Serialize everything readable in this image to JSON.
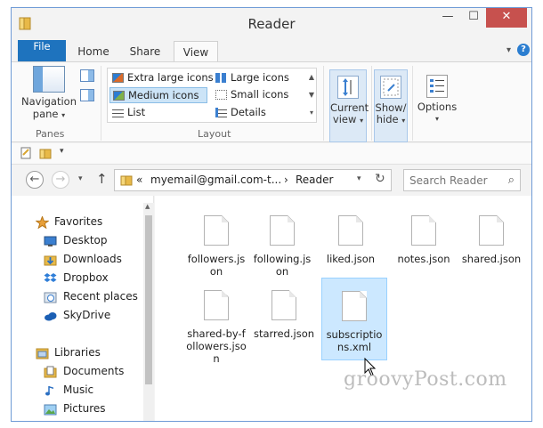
{
  "window": {
    "title": "Reader"
  },
  "tabs": [
    {
      "label": "File"
    },
    {
      "label": "Home"
    },
    {
      "label": "Share"
    },
    {
      "label": "View"
    }
  ],
  "ribbon": {
    "panes": {
      "nav_label_1": "Navigation",
      "nav_label_2": "pane",
      "group_label": "Panes"
    },
    "layout": {
      "group_label": "Layout",
      "options": [
        {
          "label": "Extra large icons",
          "icon": "extra-large-icons-icon"
        },
        {
          "label": "Large icons",
          "icon": "large-icons-icon"
        },
        {
          "label": "Medium icons",
          "icon": "medium-icons-icon",
          "selected": true
        },
        {
          "label": "Small icons",
          "icon": "small-icons-icon"
        },
        {
          "label": "List",
          "icon": "list-icon"
        },
        {
          "label": "Details",
          "icon": "details-icon"
        }
      ]
    },
    "current_view": {
      "line1": "Current",
      "line2": "view"
    },
    "show_hide": {
      "line1": "Show/",
      "line2": "hide"
    },
    "options": {
      "line1": "Options"
    }
  },
  "address": {
    "overflow": "«",
    "crumbs": [
      "myemail@gmail.com-t...",
      "Reader"
    ],
    "separator": "›"
  },
  "search": {
    "placeholder": "Search Reader"
  },
  "sidebar": {
    "items": [
      {
        "label": "Favorites",
        "icon": "star-icon"
      },
      {
        "label": "Desktop",
        "icon": "desktop-icon"
      },
      {
        "label": "Downloads",
        "icon": "downloads-icon"
      },
      {
        "label": "Dropbox",
        "icon": "dropbox-icon"
      },
      {
        "label": "Recent places",
        "icon": "recent-places-icon"
      },
      {
        "label": "SkyDrive",
        "icon": "skydrive-icon"
      },
      {
        "label": "Libraries",
        "icon": "libraries-icon"
      },
      {
        "label": "Documents",
        "icon": "documents-icon"
      },
      {
        "label": "Music",
        "icon": "music-icon"
      },
      {
        "label": "Pictures",
        "icon": "pictures-icon"
      }
    ]
  },
  "files": [
    {
      "name": "followers.json"
    },
    {
      "name": "following.json"
    },
    {
      "name": "liked.json"
    },
    {
      "name": "notes.json"
    },
    {
      "name": "shared.json"
    },
    {
      "name": "shared-by-followers.json"
    },
    {
      "name": "starred.json"
    },
    {
      "name": "subscriptions.xml",
      "selected": true
    }
  ],
  "watermark": "groovyPost.com",
  "colors": {
    "accent": "#1e73be",
    "selection": "#cce8ff",
    "close": "#c7514e"
  }
}
